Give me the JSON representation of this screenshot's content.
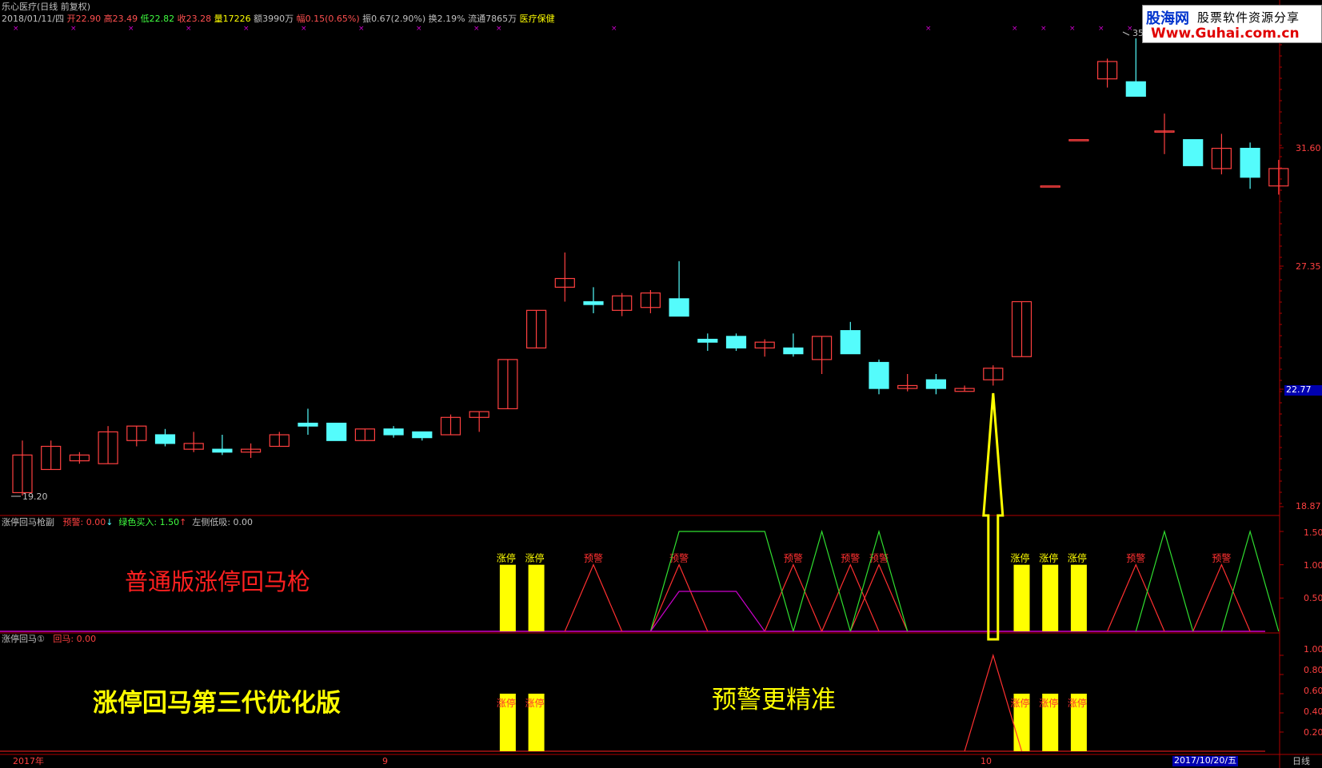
{
  "header": {
    "title": "乐心医疗(日线 前复权)",
    "date": "2018/01/11/四",
    "open_label": "开",
    "open": "22.90",
    "high_label": "高",
    "high": "23.49",
    "low_label": "低",
    "low": "22.82",
    "close_label": "收",
    "close": "23.28",
    "vol_label": "量",
    "vol": "17226",
    "amt_label": "额",
    "amt": "3990万",
    "chg_label": "幅",
    "chg": "0.15(0.65%)",
    "amp_label": "振",
    "amp": "0.67(2.90%)",
    "turn_label": "换",
    "turn": "2.19%",
    "float_label": "流通",
    "float": "7865万",
    "sector": "医疗保健"
  },
  "logo": {
    "cn": "股海网",
    "tag": "股票软件资源分享",
    "url": "Www.Guhai.com.cn"
  },
  "price_axis": {
    "p1": "31.60",
    "p2": "27.35",
    "cur": "22.77",
    "p4": "18.87"
  },
  "price_marks": {
    "high_mark": "35",
    "low_mark": "19.20"
  },
  "panel1": {
    "name": "涨停回马枪副",
    "warn": "预警: 0.00",
    "buy": "绿色买入: 1.50",
    "left": "左侧低吸: 0.00",
    "axis": [
      "1.50",
      "1.00",
      "0.50"
    ],
    "annot": "普通版涨停回马枪",
    "zt": "涨停",
    "yj": "预警"
  },
  "panel2": {
    "name": "涨停回马①",
    "huima": "回马: 0.00",
    "axis": [
      "1.00",
      "0.80",
      "0.60",
      "0.40",
      "0.20"
    ],
    "annot": "涨停回马第三代优化版",
    "annot2": "预警更精准"
  },
  "time_axis": {
    "start": "2017年",
    "m9": "9",
    "m10": "10",
    "cur_date": "2017/10/20/五",
    "period": "日线"
  },
  "colors": {
    "up": "#ff4040",
    "down": "#54fcfc",
    "zt": "#ffff00",
    "bg": "#000000",
    "axis": "#b00000"
  },
  "chart_data": {
    "type": "candlestick",
    "ylim": [
      18.87,
      35.0
    ],
    "candles": [
      {
        "o": 19.3,
        "c": 20.6,
        "h": 21.1,
        "l": 19.2
      },
      {
        "o": 20.1,
        "c": 20.9,
        "h": 21.1,
        "l": 20.1
      },
      {
        "o": 20.4,
        "c": 20.6,
        "h": 20.7,
        "l": 20.3
      },
      {
        "o": 20.3,
        "c": 21.4,
        "h": 21.6,
        "l": 20.3
      },
      {
        "o": 21.1,
        "c": 21.6,
        "h": 21.6,
        "l": 20.9
      },
      {
        "o": 21.3,
        "c": 21.0,
        "h": 21.5,
        "l": 20.9
      },
      {
        "o": 20.8,
        "c": 21.0,
        "h": 21.4,
        "l": 20.7
      },
      {
        "o": 20.8,
        "c": 20.7,
        "h": 21.3,
        "l": 20.6
      },
      {
        "o": 20.7,
        "c": 20.8,
        "h": 21.0,
        "l": 20.5
      },
      {
        "o": 20.9,
        "c": 21.3,
        "h": 21.4,
        "l": 20.9
      },
      {
        "o": 21.7,
        "c": 21.6,
        "h": 22.2,
        "l": 21.3
      },
      {
        "o": 21.7,
        "c": 21.1,
        "h": 21.7,
        "l": 21.1
      },
      {
        "o": 21.1,
        "c": 21.5,
        "h": 21.5,
        "l": 21.1
      },
      {
        "o": 21.5,
        "c": 21.3,
        "h": 21.6,
        "l": 21.2
      },
      {
        "o": 21.4,
        "c": 21.2,
        "h": 21.4,
        "l": 21.1
      },
      {
        "o": 21.3,
        "c": 21.9,
        "h": 22.0,
        "l": 21.3
      },
      {
        "o": 21.9,
        "c": 22.1,
        "h": 22.1,
        "l": 21.4
      },
      {
        "o": 22.2,
        "c": 23.9,
        "h": 23.9,
        "l": 22.2
      },
      {
        "o": 24.3,
        "c": 25.6,
        "h": 25.6,
        "l": 24.3
      },
      {
        "o": 26.4,
        "c": 26.7,
        "h": 27.6,
        "l": 25.9
      },
      {
        "o": 25.9,
        "c": 25.8,
        "h": 26.4,
        "l": 25.5
      },
      {
        "o": 25.6,
        "c": 26.1,
        "h": 26.2,
        "l": 25.4
      },
      {
        "o": 25.7,
        "c": 26.2,
        "h": 26.3,
        "l": 25.5
      },
      {
        "o": 26.0,
        "c": 25.4,
        "h": 27.3,
        "l": 25.4
      },
      {
        "o": 24.6,
        "c": 24.5,
        "h": 24.8,
        "l": 24.2
      },
      {
        "o": 24.7,
        "c": 24.3,
        "h": 24.8,
        "l": 24.2
      },
      {
        "o": 24.3,
        "c": 24.5,
        "h": 24.6,
        "l": 24.0
      },
      {
        "o": 24.3,
        "c": 24.1,
        "h": 24.8,
        "l": 24.0
      },
      {
        "o": 23.9,
        "c": 24.7,
        "h": 24.7,
        "l": 23.4
      },
      {
        "o": 24.9,
        "c": 24.1,
        "h": 25.2,
        "l": 24.1
      },
      {
        "o": 23.8,
        "c": 22.9,
        "h": 23.9,
        "l": 22.7
      },
      {
        "o": 22.9,
        "c": 23.0,
        "h": 23.4,
        "l": 22.8
      },
      {
        "o": 23.2,
        "c": 22.9,
        "h": 23.4,
        "l": 22.7
      },
      {
        "o": 22.8,
        "c": 22.9,
        "h": 23.0,
        "l": 22.8
      },
      {
        "o": 23.2,
        "c": 23.6,
        "h": 23.7,
        "l": 23.0
      },
      {
        "o": 24.0,
        "c": 25.9,
        "h": 25.9,
        "l": 24.0
      },
      {
        "o": 29.9,
        "c": 29.9,
        "h": 29.9,
        "l": 29.9
      },
      {
        "o": 31.5,
        "c": 31.5,
        "h": 31.5,
        "l": 31.5
      },
      {
        "o": 33.6,
        "c": 34.2,
        "h": 34.3,
        "l": 33.3
      },
      {
        "o": 33.5,
        "c": 33.0,
        "h": 35.0,
        "l": 33.0
      },
      {
        "o": 31.8,
        "c": 31.8,
        "h": 32.4,
        "l": 31.0
      },
      {
        "o": 31.5,
        "c": 30.6,
        "h": 31.5,
        "l": 30.6
      },
      {
        "o": 30.5,
        "c": 31.2,
        "h": 31.7,
        "l": 30.3
      },
      {
        "o": 31.2,
        "c": 30.2,
        "h": 31.4,
        "l": 29.8
      },
      {
        "o": 29.9,
        "c": 30.5,
        "h": 30.8,
        "l": 29.6
      }
    ],
    "zt_p1": [
      17,
      18,
      35,
      36,
      37
    ],
    "warn_p1": [
      [
        19,
        20,
        21
      ],
      [
        22,
        23,
        24
      ],
      [
        26,
        27,
        28
      ],
      [
        28,
        29,
        30
      ],
      [
        29,
        30,
        31
      ],
      [
        38,
        39,
        40
      ],
      [
        41,
        42,
        43
      ]
    ],
    "buy_p1": [
      [
        22,
        23,
        25,
        26,
        27
      ],
      [
        27,
        28,
        29
      ],
      [
        29,
        30,
        31
      ],
      [
        39,
        40,
        41
      ],
      [
        42,
        43,
        44
      ]
    ],
    "left_p1": [
      [
        22,
        23,
        24,
        25,
        26
      ]
    ],
    "zt_p2": [
      17,
      18,
      35,
      36,
      37
    ],
    "huima_p2": [
      [
        33,
        34,
        35
      ]
    ]
  }
}
